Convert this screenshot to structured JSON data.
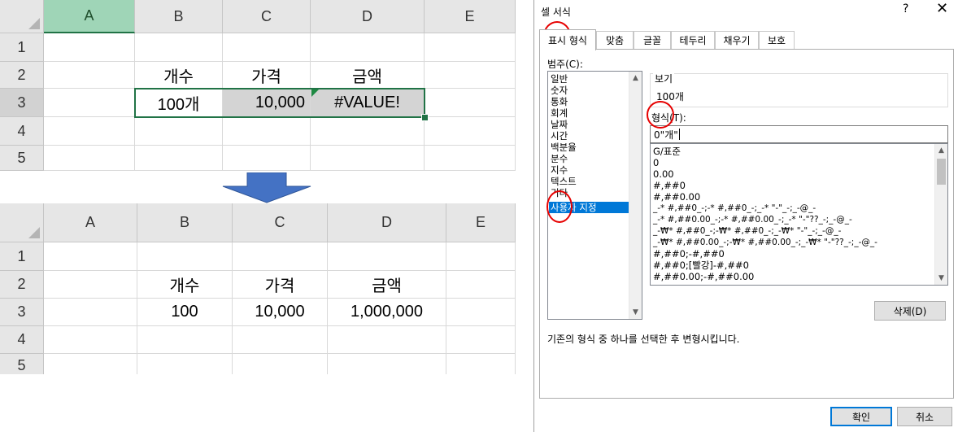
{
  "top_sheet": {
    "columns": [
      "A",
      "B",
      "C",
      "D",
      "E"
    ],
    "rows": [
      "1",
      "2",
      "3",
      "4",
      "5"
    ],
    "headers": [
      "개수",
      "가격",
      "금액"
    ],
    "values": [
      "100개",
      "10,000",
      "#VALUE!"
    ]
  },
  "bottom_sheet": {
    "columns": [
      "A",
      "B",
      "C",
      "D",
      "E"
    ],
    "rows": [
      "1",
      "2",
      "3",
      "4",
      "5"
    ],
    "headers": [
      "개수",
      "가격",
      "금액"
    ],
    "values": [
      "100",
      "10,000",
      "1,000,000"
    ]
  },
  "arrow": {
    "color": "#4472c4"
  },
  "dialog": {
    "title": "셀 서식",
    "help": "?",
    "close": "✕",
    "tabs": [
      "표시 형식",
      "맞춤",
      "글꼴",
      "테두리",
      "채우기",
      "보호"
    ],
    "category_label": "범주(C):",
    "categories": [
      "일반",
      "숫자",
      "통화",
      "회계",
      "날짜",
      "시간",
      "백분율",
      "분수",
      "지수",
      "텍스트",
      "기타",
      "사용자 지정"
    ],
    "preview_label": "보기",
    "preview_value": "100개",
    "format_label": "형식(T):",
    "format_value": "0\"개\"",
    "format_list": [
      "G/표준",
      "0",
      "0.00",
      "#,##0",
      "#,##0.00",
      "_-* #,##0_-;-* #,##0_-;_-* \"-\"_-;_-@_-",
      "_-* #,##0.00_-;-* #,##0.00_-;_-* \"-\"??_-;_-@_-",
      "_-₩* #,##0_-;-₩* #,##0_-;_-₩* \"-\"_-;_-@_-",
      "_-₩* #,##0.00_-;-₩* #,##0.00_-;_-₩* \"-\"??_-;_-@_-",
      "#,##0;-#,##0",
      "#,##0;[빨강]-#,##0",
      "#,##0.00;-#,##0.00"
    ],
    "delete_button": "삭제(D)",
    "hint": "기존의 형식 중 하나를 선택한 후 변형시킵니다.",
    "ok_button": "확인",
    "cancel_button": "취소",
    "highlight_color": "#e60000",
    "selection_color": "#0078d7"
  }
}
